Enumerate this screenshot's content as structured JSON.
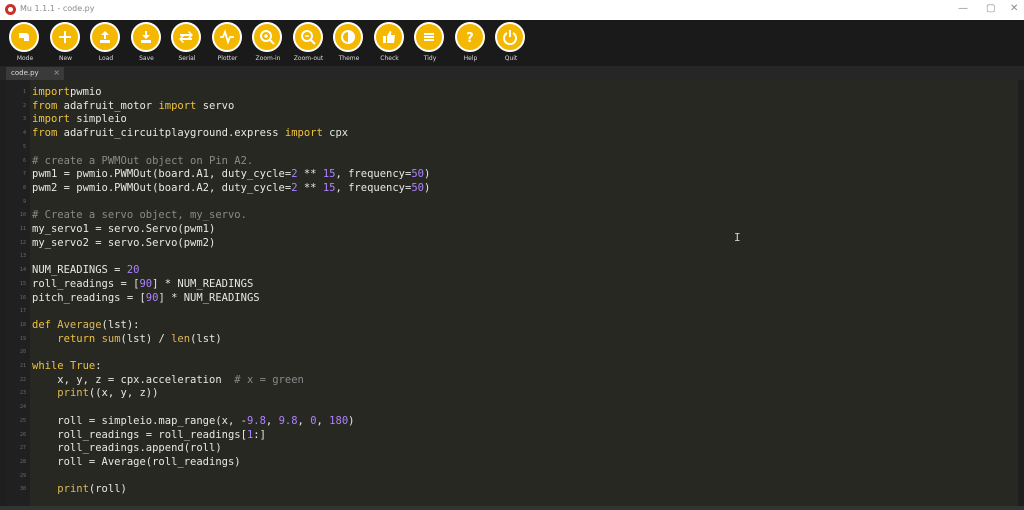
{
  "window": {
    "title": "Mu 1.1.1 - code.py",
    "minimize_glyph": "—",
    "maximize_glyph": "▢",
    "close_glyph": "✕"
  },
  "toolbar": [
    {
      "label": "Mode",
      "icon": "mode-icon"
    },
    {
      "label": "New",
      "icon": "plus-icon"
    },
    {
      "label": "Load",
      "icon": "upload-icon"
    },
    {
      "label": "Save",
      "icon": "download-icon"
    },
    {
      "label": "Serial",
      "icon": "arrows-icon"
    },
    {
      "label": "Plotter",
      "icon": "waveform-icon"
    },
    {
      "label": "Zoom-in",
      "icon": "zoom-in-icon"
    },
    {
      "label": "Zoom-out",
      "icon": "zoom-out-icon"
    },
    {
      "label": "Theme",
      "icon": "theme-icon"
    },
    {
      "label": "Check",
      "icon": "thumbs-up-icon"
    },
    {
      "label": "Tidy",
      "icon": "lines-icon"
    },
    {
      "label": "Help",
      "icon": "question-icon"
    },
    {
      "label": "Quit",
      "icon": "power-icon"
    }
  ],
  "tab": {
    "label": "code.py",
    "close": "×"
  },
  "editor": {
    "cursor_glyph": "I",
    "lines": [
      {
        "n": "1",
        "segs": [
          [
            "kw",
            "import"
          ],
          [
            "",
            "pwmio"
          ]
        ]
      },
      {
        "n": "2",
        "segs": [
          [
            "kw",
            "from"
          ],
          [
            "",
            " adafruit_motor "
          ],
          [
            "kw",
            "import"
          ],
          [
            "",
            " servo"
          ]
        ]
      },
      {
        "n": "3",
        "segs": [
          [
            "kw",
            "import"
          ],
          [
            "",
            " simpleio"
          ]
        ]
      },
      {
        "n": "4",
        "segs": [
          [
            "kw",
            "from"
          ],
          [
            "",
            " adafruit_circuitplayground.express "
          ],
          [
            "kw",
            "import"
          ],
          [
            "",
            " cpx"
          ]
        ]
      },
      {
        "n": "5",
        "segs": []
      },
      {
        "n": "6",
        "segs": [
          [
            "cm",
            "# create a PWMOut object on Pin A2."
          ]
        ]
      },
      {
        "n": "7",
        "segs": [
          [
            "",
            "pwm1 = pwmio.PWMOut(board.A1, duty_cycle="
          ],
          [
            "num",
            "2"
          ],
          [
            "",
            " ** "
          ],
          [
            "num",
            "15"
          ],
          [
            "",
            ", frequency="
          ],
          [
            "num",
            "50"
          ],
          [
            "",
            ")"
          ]
        ]
      },
      {
        "n": "8",
        "segs": [
          [
            "",
            "pwm2 = pwmio.PWMOut(board.A2, duty_cycle="
          ],
          [
            "num",
            "2"
          ],
          [
            "",
            " ** "
          ],
          [
            "num",
            "15"
          ],
          [
            "",
            ", frequency="
          ],
          [
            "num",
            "50"
          ],
          [
            "",
            ")"
          ]
        ]
      },
      {
        "n": "9",
        "segs": []
      },
      {
        "n": "10",
        "segs": [
          [
            "cm",
            "# Create a servo object, my_servo."
          ]
        ]
      },
      {
        "n": "11",
        "segs": [
          [
            "",
            "my_servo1 = servo.Servo(pwm1)"
          ]
        ]
      },
      {
        "n": "12",
        "segs": [
          [
            "",
            "my_servo2 = servo.Servo(pwm2)"
          ]
        ]
      },
      {
        "n": "13",
        "segs": []
      },
      {
        "n": "14",
        "segs": [
          [
            "",
            "NUM_READINGS = "
          ],
          [
            "num",
            "20"
          ]
        ]
      },
      {
        "n": "15",
        "segs": [
          [
            "",
            "roll_readings = ["
          ],
          [
            "num",
            "90"
          ],
          [
            "",
            "] * NUM_READINGS"
          ]
        ]
      },
      {
        "n": "16",
        "segs": [
          [
            "",
            "pitch_readings = ["
          ],
          [
            "num",
            "90"
          ],
          [
            "",
            "] * NUM_READINGS"
          ]
        ]
      },
      {
        "n": "17",
        "segs": []
      },
      {
        "n": "18",
        "segs": [
          [
            "kw",
            "def"
          ],
          [
            "st",
            " Average"
          ],
          [
            "",
            "(lst):"
          ]
        ]
      },
      {
        "n": "19",
        "segs": [
          [
            "",
            "    "
          ],
          [
            "kw",
            "return"
          ],
          [
            "",
            " "
          ],
          [
            "st",
            "sum"
          ],
          [
            "",
            "(lst) / "
          ],
          [
            "st",
            "len"
          ],
          [
            "",
            "(lst)"
          ]
        ]
      },
      {
        "n": "20",
        "segs": []
      },
      {
        "n": "21",
        "segs": [
          [
            "kw",
            "while"
          ],
          [
            "",
            " "
          ],
          [
            "kw",
            "True"
          ],
          [
            "",
            ":"
          ]
        ]
      },
      {
        "n": "22",
        "segs": [
          [
            "",
            "    x, y, z = cpx.acceleration  "
          ],
          [
            "cm",
            "# x = green"
          ]
        ]
      },
      {
        "n": "23",
        "segs": [
          [
            "",
            "    "
          ],
          [
            "st",
            "print"
          ],
          [
            "",
            "((x, y, z))"
          ]
        ]
      },
      {
        "n": "24",
        "segs": []
      },
      {
        "n": "25",
        "segs": [
          [
            "",
            "    roll = simpleio.map_range(x, -"
          ],
          [
            "num",
            "9.8"
          ],
          [
            "",
            ", "
          ],
          [
            "num",
            "9.8"
          ],
          [
            "",
            ", "
          ],
          [
            "num",
            "0"
          ],
          [
            "",
            ", "
          ],
          [
            "num",
            "180"
          ],
          [
            "",
            ")"
          ]
        ]
      },
      {
        "n": "26",
        "segs": [
          [
            "",
            "    roll_readings = roll_readings["
          ],
          [
            "num",
            "1"
          ],
          [
            "",
            ":]"
          ]
        ]
      },
      {
        "n": "27",
        "segs": [
          [
            "",
            "    roll_readings.append(roll)"
          ]
        ]
      },
      {
        "n": "28",
        "segs": [
          [
            "",
            "    roll = Average(roll_readings)"
          ]
        ]
      },
      {
        "n": "29",
        "segs": []
      },
      {
        "n": "30",
        "segs": [
          [
            "",
            "    "
          ],
          [
            "st",
            "print"
          ],
          [
            "",
            "(roll)"
          ]
        ]
      }
    ]
  }
}
